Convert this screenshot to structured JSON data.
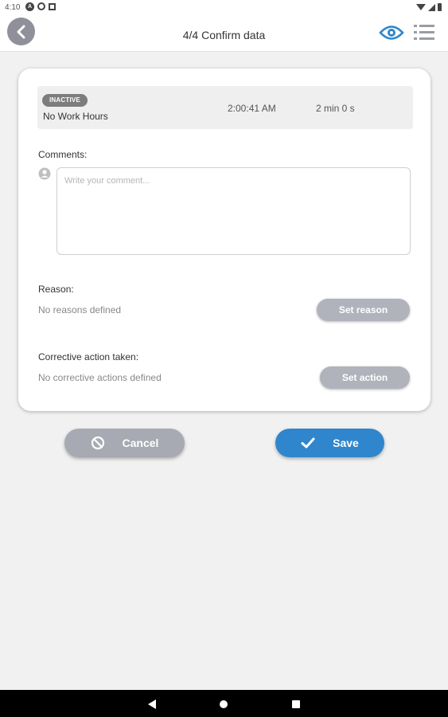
{
  "status_bar": {
    "time": "4:10",
    "notification_badge": "A"
  },
  "app_bar": {
    "title": "4/4  Confirm data",
    "accent_color": "#2f86cc"
  },
  "record": {
    "status": "INACTIVE",
    "name": "No Work Hours",
    "time": "2:00:41 AM",
    "duration": "2 min 0 s"
  },
  "comments": {
    "label": "Comments:",
    "value": "",
    "placeholder": "Write your comment..."
  },
  "reason": {
    "label": "Reason:",
    "empty_text": "No reasons defined",
    "button_label": "Set reason"
  },
  "corrective_action": {
    "label": "Corrective action taken:",
    "empty_text": "No corrective actions defined",
    "button_label": "Set action"
  },
  "actions": {
    "cancel_label": "Cancel",
    "save_label": "Save"
  },
  "icons": {
    "back": "chevron-left-icon",
    "view": "eye-icon",
    "list": "list-icon",
    "user": "user-icon",
    "cancel": "ban-icon",
    "save": "check-icon"
  }
}
